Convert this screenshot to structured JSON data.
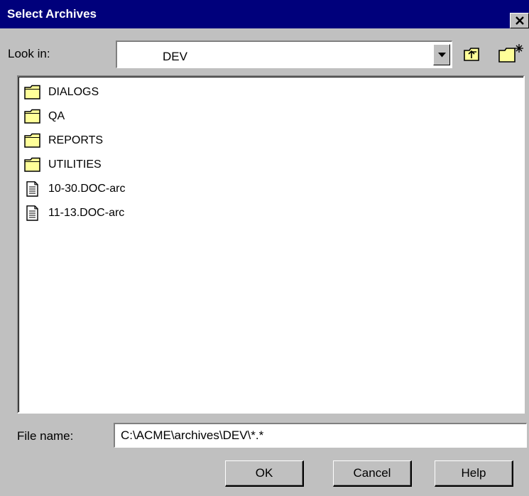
{
  "window": {
    "title": "Select Archives",
    "close_icon": "close-icon"
  },
  "look_in": {
    "label": "Look in:",
    "value": "DEV",
    "up_icon": "up-one-level-icon",
    "new_folder_icon": "new-folder-icon"
  },
  "files": [
    {
      "name": "DIALOGS",
      "type": "folder"
    },
    {
      "name": "QA",
      "type": "folder"
    },
    {
      "name": "REPORTS",
      "type": "folder"
    },
    {
      "name": "UTILITIES",
      "type": "folder"
    },
    {
      "name": "10-30.DOC-arc",
      "type": "file"
    },
    {
      "name": "11-13.DOC-arc",
      "type": "file"
    }
  ],
  "file_name": {
    "label": "File name:",
    "value": "C:\\ACME\\archives\\DEV\\*.*"
  },
  "buttons": {
    "ok": "OK",
    "cancel": "Cancel",
    "help": "Help"
  },
  "colors": {
    "title_bar": "#00007b",
    "face": "#c0c0c0",
    "folder_fill": "#ffff99"
  }
}
